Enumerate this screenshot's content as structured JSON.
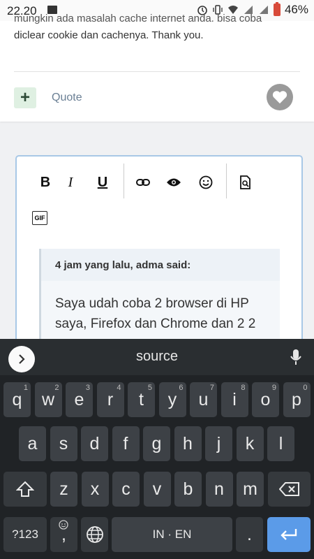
{
  "status_bar": {
    "time": "22.20",
    "battery": "46%"
  },
  "post": {
    "clipped_text": "mungkin ada masalah cache internet anda. bisa coba",
    "text": "diclear cookie dan cachenya. Thank you.",
    "quote_label": "Quote",
    "plus_label": "+"
  },
  "toolbar": {
    "bold": "B",
    "italic": "I",
    "underline": "U",
    "gif": "GIF"
  },
  "quote": {
    "header": "4 jam yang lalu, adma said:",
    "body_line1": "Saya udah coba 2 browser di HP",
    "body_line2": "saya, Firefox dan Chrome dan 2 2"
  },
  "keyboard": {
    "suggestion": "source",
    "row1": [
      {
        "k": "q",
        "h": "1"
      },
      {
        "k": "w",
        "h": "2"
      },
      {
        "k": "e",
        "h": "3"
      },
      {
        "k": "r",
        "h": "4"
      },
      {
        "k": "t",
        "h": "5"
      },
      {
        "k": "y",
        "h": "6"
      },
      {
        "k": "u",
        "h": "7"
      },
      {
        "k": "i",
        "h": "8"
      },
      {
        "k": "o",
        "h": "9"
      },
      {
        "k": "p",
        "h": "0"
      }
    ],
    "row2": [
      "a",
      "s",
      "d",
      "f",
      "g",
      "h",
      "j",
      "k",
      "l"
    ],
    "row3": [
      "z",
      "x",
      "c",
      "v",
      "b",
      "n",
      "m"
    ],
    "sym_label": "?123",
    "comma_label": ",",
    "space_label": "IN · EN",
    "period_label": "."
  }
}
